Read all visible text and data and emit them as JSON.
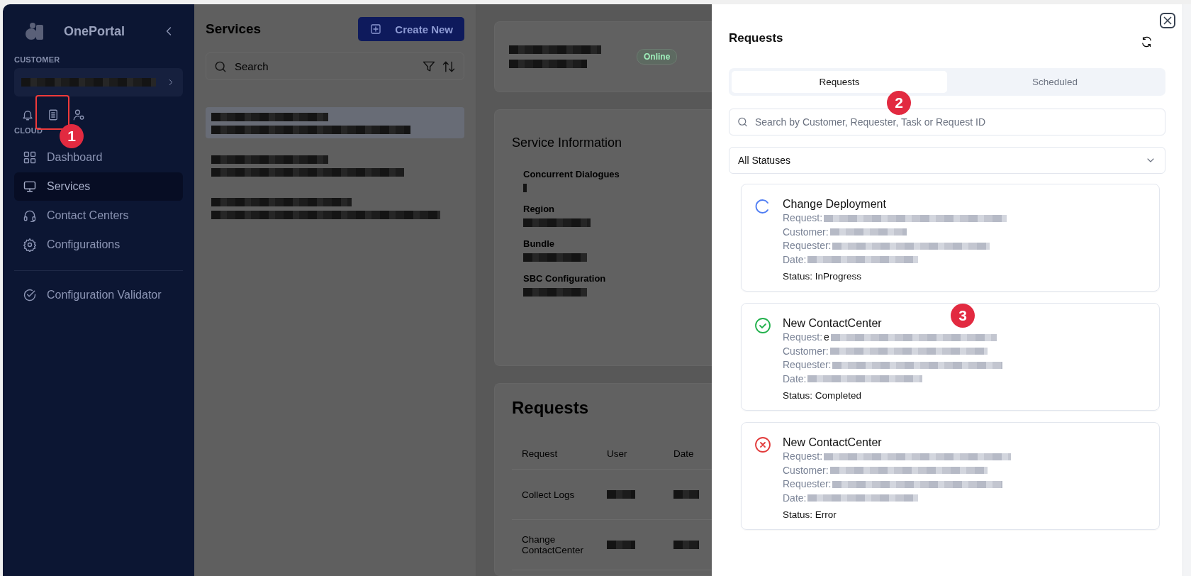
{
  "sidebar": {
    "brand": "OnePortal",
    "customer_label": "CUSTOMER",
    "cloud_label": "CLOUD",
    "nav": [
      {
        "label": "Dashboard",
        "selected": false
      },
      {
        "label": "Services",
        "selected": true
      },
      {
        "label": "Contact Centers",
        "selected": false
      },
      {
        "label": "Configurations",
        "selected": false
      }
    ],
    "footer_nav": [
      {
        "label": "Configuration Validator",
        "selected": false
      }
    ]
  },
  "services": {
    "title": "Services",
    "create_button": "Create New",
    "search": {
      "placeholder": "Search"
    },
    "items": [
      {
        "selected": true
      },
      {
        "selected": false
      },
      {
        "selected": false
      }
    ]
  },
  "service_header": {
    "status_badge": "Online"
  },
  "service_information": {
    "title": "Service Information",
    "fields": [
      {
        "label": "Concurrent Dialogues"
      },
      {
        "label": "Region"
      },
      {
        "label": "Bundle"
      },
      {
        "label": "SBC Configuration"
      }
    ]
  },
  "requests_table": {
    "title": "Requests",
    "columns": [
      "Request",
      "User",
      "Date"
    ],
    "rows": [
      {
        "request": "Collect Logs"
      },
      {
        "request": "Change ContactCenter"
      }
    ]
  },
  "drawer": {
    "title": "Requests",
    "tabs": [
      {
        "label": "Requests",
        "selected": true
      },
      {
        "label": "Scheduled",
        "selected": false
      }
    ],
    "search": {
      "placeholder": "Search by Customer, Requester, Task or Request ID"
    },
    "status_filter": {
      "value": "All Statuses"
    },
    "requests": [
      {
        "title": "Change Deployment",
        "kind": "in_progress",
        "fields": [
          {
            "label": "Request:"
          },
          {
            "label": "Customer:"
          },
          {
            "label": "Requester:"
          },
          {
            "label": "Date:"
          }
        ],
        "status_text": "Status: InProgress"
      },
      {
        "title": "New ContactCenter",
        "kind": "completed",
        "fields": [
          {
            "label": "Request:",
            "value": "e"
          },
          {
            "label": "Customer:"
          },
          {
            "label": "Requester:"
          },
          {
            "label": "Date:"
          }
        ],
        "status_text": "Status: Completed"
      },
      {
        "title": "New ContactCenter",
        "kind": "error",
        "fields": [
          {
            "label": "Request:"
          },
          {
            "label": "Customer:"
          },
          {
            "label": "Requester:"
          },
          {
            "label": "Date:"
          }
        ],
        "status_text": "Status: Error"
      }
    ]
  },
  "annotations": [
    {
      "number": "1"
    },
    {
      "number": "2"
    },
    {
      "number": "3"
    }
  ]
}
